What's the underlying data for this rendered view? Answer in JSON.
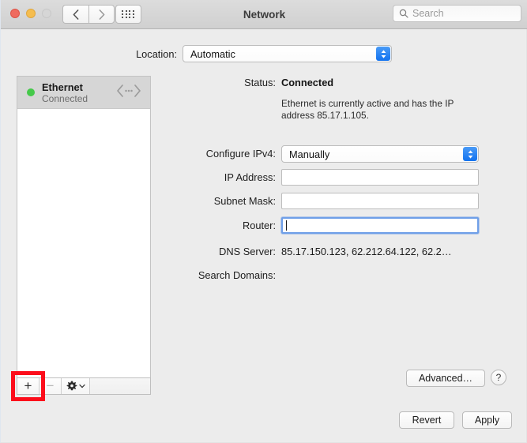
{
  "window": {
    "title": "Network",
    "traffic_lights": [
      {
        "name": "close",
        "color": "#ef6b5f",
        "enabled": true
      },
      {
        "name": "minimize",
        "color": "#f5bd4f",
        "enabled": true
      },
      {
        "name": "zoom",
        "color": "#d6d6d6",
        "enabled": false
      }
    ],
    "nav": {
      "back_icon": "chevron-left-icon",
      "forward_icon": "chevron-right-icon",
      "grid_icon": "show-all-grid-icon"
    }
  },
  "search": {
    "placeholder": "Search",
    "value": "",
    "icon": "search-icon"
  },
  "location": {
    "label": "Location:",
    "selected": "Automatic",
    "options": [
      "Automatic"
    ]
  },
  "sidebar": {
    "services": [
      {
        "name": "Ethernet",
        "status": "Connected",
        "status_color": "#45c94a",
        "icon": "ethernet-connector-icon",
        "selected": true
      }
    ],
    "toolbar": {
      "add_label": "+",
      "remove_label": "−",
      "gear_icon": "gear-icon",
      "gear_chevron_icon": "chevron-down-icon",
      "remove_enabled": false
    }
  },
  "detail": {
    "status": {
      "label": "Status:",
      "value": "Connected",
      "description": "Ethernet is currently active and has the IP address 85.17.1.105."
    },
    "configure_ipv4": {
      "label": "Configure IPv4:",
      "selected": "Manually",
      "options": [
        "Manually"
      ]
    },
    "ip_address": {
      "label": "IP Address:",
      "value": "",
      "focused": false
    },
    "subnet_mask": {
      "label": "Subnet Mask:",
      "value": "",
      "focused": false
    },
    "router": {
      "label": "Router:",
      "value": "",
      "focused": true
    },
    "dns_server": {
      "label": "DNS Server:",
      "value": "85.17.150.123, 62.212.64.122, 62.2…"
    },
    "search_domains": {
      "label": "Search Domains:",
      "value": ""
    }
  },
  "buttons": {
    "advanced": "Advanced…",
    "help": "?",
    "revert": "Revert",
    "apply": "Apply"
  },
  "annotation": {
    "type": "highlight-rectangle",
    "color": "#fc0d1b",
    "target": "add-service-button"
  }
}
